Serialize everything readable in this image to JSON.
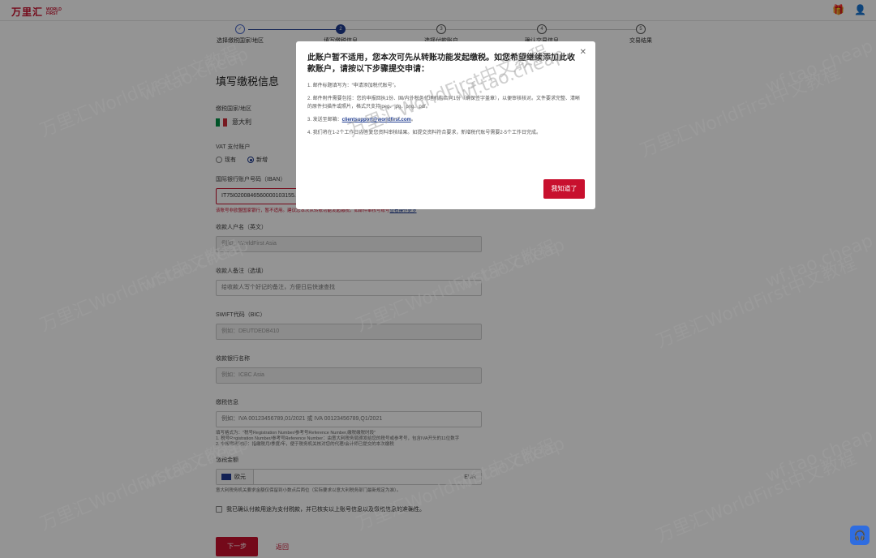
{
  "brand": {
    "cn": "万里汇",
    "en_line1": "WORLD",
    "en_line2": "FIRST"
  },
  "header": {
    "gift_icon": "gift-icon",
    "user_icon": "user-icon"
  },
  "steps": [
    {
      "num": "",
      "label": "选择缴税国家/地区"
    },
    {
      "num": "2",
      "label": "填写缴税信息"
    },
    {
      "num": "3",
      "label": "选择付款账户"
    },
    {
      "num": "4",
      "label": "确认交易信息"
    },
    {
      "num": "5",
      "label": "交易结果"
    }
  ],
  "form": {
    "title": "填写缴税信息",
    "country_label": "缴税国家/地区",
    "country_value": "意大利",
    "vat_label": "VAT 支付账户",
    "radio_existing": "现有",
    "radio_new": "新增",
    "iban_label": "国际银行账户号码（IBAN）",
    "iban_value": "IT75I0200846560000103155...",
    "iban_error": "该账号非欧盟国家银行，暂不适用。建议您本次从转账功能发起缴税。如部件审核号账号",
    "iban_error_link": "查看操作更多",
    "payee_label": "收款人户名（英文）",
    "payee_placeholder": "例如：WorldFirst Asia",
    "remark_label": "收款人备注（选填）",
    "remark_placeholder": "给收款人写个好记的备注，方便日后快速查找",
    "swift_label": "SWIFT代码（BIC）",
    "swift_placeholder": "例如：DEUTDEDB410",
    "bank_label": "收款银行名称",
    "bank_placeholder": "例如：ICBC Asia",
    "tax_info_label": "缴税信息",
    "tax_info_placeholder": "例如：IVA 00123456789,01/2021 或 IVA 00123456789,Q1/2021",
    "tax_hint_1": "填写格式为：\"税号Registration Number/参考号Reference Number,缴税缴税时段\"",
    "tax_hint_2": "1. 税号Registration Number/参考号Reference Number：由意大利税务局颁发给您的税号或参考号，包含IVA开头的11位数字",
    "tax_hint_3": "2. 申报缴税时段：指缴税月/季度/年，便于税务机关核对您的代理/会计师已提交的本次缴税",
    "amount_label": "缴税金额",
    "currency": "欧元",
    "amount_unit": "EUR",
    "amount_hint": "意大利税务机关要求金额仅保留到小数点后两位（实际要求以意大利税务部门最新规定为准）。",
    "confirm_text": "我已确认付款用途为支付税款，并已核实以上账号信息以及缴税信息的准确性。",
    "next_button": "下一步",
    "back_button": "返回"
  },
  "modal": {
    "title": "此账户暂不适用，您本次可先从转账功能发起缴税。如您希望继续添加此收款账户，请按以下步骤提交申请：",
    "item1": "1. 邮件标题填写为：“申请添加税代账号”。",
    "item2": "2. 邮件附件需要包括：您的申报回执1份、国/内外税务代理机构合同1份（确保签字盖章），以便审核核对。文件要求完整、清晰的原件扫描件或照片，格式只支持jpeg、jpg、png、pdf。",
    "item3_prefix": "3. 发送至邮箱：",
    "item3_email": "clientsupport@worldfirst.com",
    "item3_suffix": "。",
    "item4": "4. 我们将在1-2个工作日内答复您资料审核结果。如提交资料符合要求，新增税代账号需要2-5个工作日完成。",
    "button": "我知道了"
  },
  "watermark": {
    "cn": "万里汇WorldFirst中文教程",
    "url": "wf.tao.cheap"
  },
  "colors": {
    "brand_red": "#c8102e",
    "step_blue": "#1d3a8f",
    "chat_blue": "#2f6de0"
  }
}
